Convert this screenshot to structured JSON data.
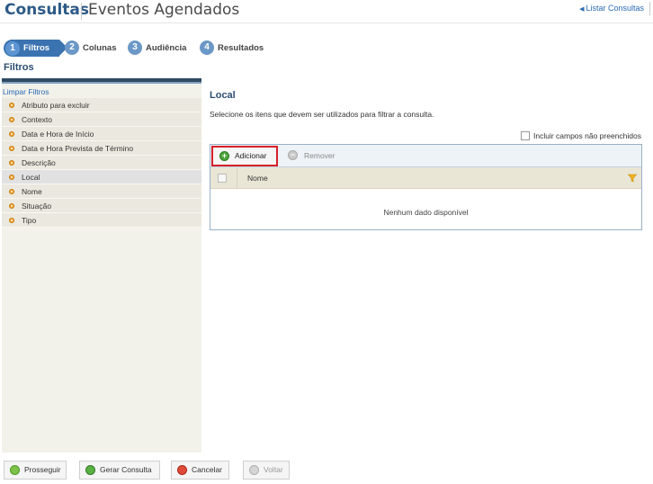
{
  "header": {
    "title": "Consultas",
    "subtitle": "Eventos Agendados",
    "list_link": "Listar Consultas",
    "list_link_arrow": "◀"
  },
  "steps": [
    {
      "number": "1",
      "label": "Filtros",
      "active": true
    },
    {
      "number": "2",
      "label": "Colunas",
      "active": false
    },
    {
      "number": "3",
      "label": "Audiência",
      "active": false
    },
    {
      "number": "4",
      "label": "Resultados",
      "active": false
    }
  ],
  "sidebar": {
    "heading": "Filtros",
    "clear_link": "Limpar Filtros",
    "items": [
      {
        "label": "Atributo para excluir"
      },
      {
        "label": "Contexto"
      },
      {
        "label": "Data e Hora de Início"
      },
      {
        "label": "Data e Hora Prevista de Término"
      },
      {
        "label": "Descrição"
      },
      {
        "label": "Local",
        "active": true
      },
      {
        "label": "Nome"
      },
      {
        "label": "Situação"
      },
      {
        "label": "Tipo"
      }
    ]
  },
  "content": {
    "title": "Local",
    "description": "Selecione os itens que devem ser utilizados para filtrar a consulta.",
    "include_empty_label": "Incluir campos não preenchidos",
    "toolbar": {
      "add_label": "Adicionar",
      "remove_label": "Remover"
    },
    "grid": {
      "column_name": "Nome",
      "empty_message": "Nenhum dado disponível"
    }
  },
  "footer": {
    "proceed_label": "Prosseguir",
    "generate_label": "Gerar Consulta",
    "cancel_label": "Cancelar",
    "back_label": "Voltar"
  },
  "colors": {
    "accent": "#3b73b0",
    "title": "#2c5a86",
    "highlight": "#d7202a"
  }
}
